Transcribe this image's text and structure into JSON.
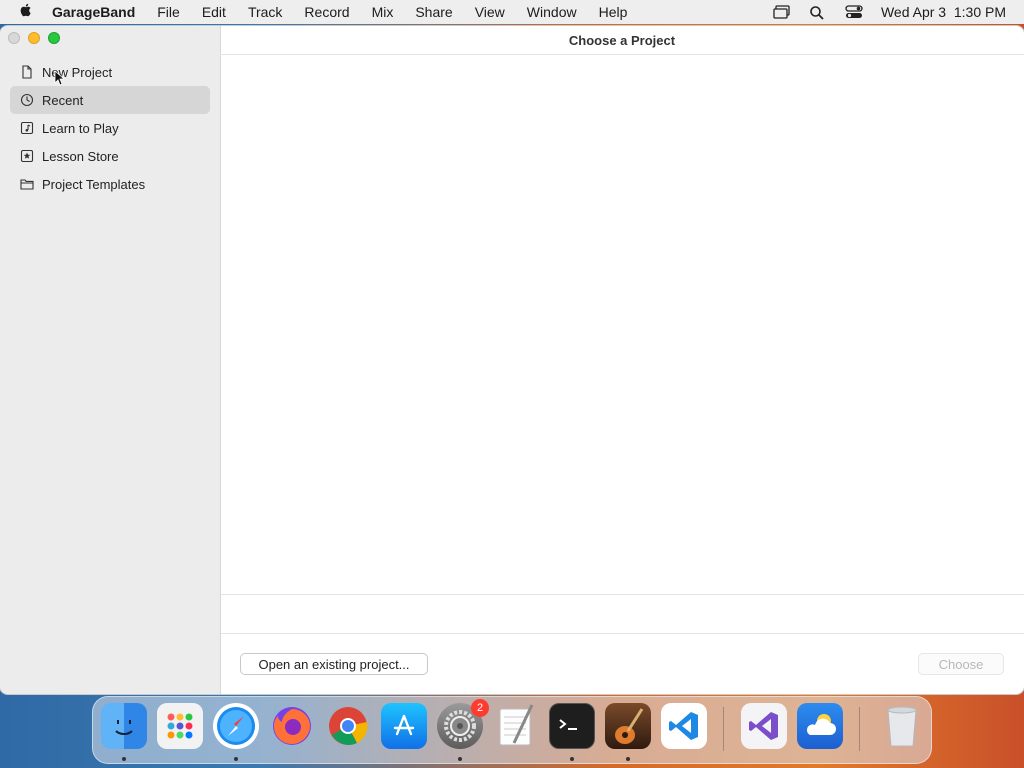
{
  "menubar": {
    "app_name": "GarageBand",
    "items": [
      "File",
      "Edit",
      "Track",
      "Record",
      "Mix",
      "Share",
      "View",
      "Window",
      "Help"
    ],
    "datetime": "Wed Apr 3  1:30 PM",
    "right_icons": [
      "screen-mirroring-icon",
      "spotlight-search-icon",
      "control-center-icon"
    ]
  },
  "window": {
    "title": "Choose a Project",
    "sidebar": {
      "items": [
        {
          "label": "New Project",
          "icon": "document-icon",
          "selected": false
        },
        {
          "label": "Recent",
          "icon": "clock-icon",
          "selected": true
        },
        {
          "label": "Learn to Play",
          "icon": "music-note-icon",
          "selected": false
        },
        {
          "label": "Lesson Store",
          "icon": "star-icon",
          "selected": false
        },
        {
          "label": "Project Templates",
          "icon": "folder-icon",
          "selected": false
        }
      ]
    },
    "footer": {
      "open_existing_label": "Open an existing project...",
      "choose_label": "Choose"
    }
  },
  "dock": {
    "apps": [
      {
        "name": "Finder",
        "icon": "finder-icon",
        "running": true
      },
      {
        "name": "Launchpad",
        "icon": "launchpad-icon",
        "running": false
      },
      {
        "name": "Safari",
        "icon": "safari-icon",
        "running": true
      },
      {
        "name": "Firefox",
        "icon": "firefox-icon",
        "running": false
      },
      {
        "name": "Chrome",
        "icon": "chrome-icon",
        "running": false
      },
      {
        "name": "App Store",
        "icon": "app-store-icon",
        "running": false
      },
      {
        "name": "System Settings",
        "icon": "system-settings-icon",
        "running": true,
        "badge": "2"
      },
      {
        "name": "TextEdit",
        "icon": "textedit-icon",
        "running": false
      },
      {
        "name": "Terminal",
        "icon": "terminal-icon",
        "running": true
      },
      {
        "name": "GarageBand",
        "icon": "garageband-icon",
        "running": true
      },
      {
        "name": "VS Code",
        "icon": "vscode-icon",
        "running": false
      },
      {
        "name": "Visual Studio",
        "icon": "visual-studio-icon",
        "running": false
      },
      {
        "name": "Weather",
        "icon": "weather-icon",
        "running": false
      },
      {
        "name": "Trash",
        "icon": "trash-icon",
        "running": false
      }
    ]
  },
  "colors": {
    "selected_bg": "#d6d6d6",
    "sidebar_bg": "#ececec",
    "badge": "#ff3b30"
  }
}
